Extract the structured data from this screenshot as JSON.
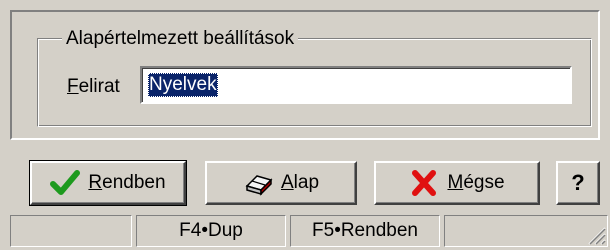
{
  "group": {
    "legend": "Alapértelmezett beállítások",
    "field_label_first": "F",
    "field_label_rest": "elirat",
    "field_value": "Nyelvek"
  },
  "buttons": {
    "ok": {
      "ul": "R",
      "rest": "endben",
      "icon": "checkmark-icon"
    },
    "default": {
      "ul": "A",
      "rest": "lap",
      "icon": "eraser-icon"
    },
    "cancel_prefix": "",
    "cancel": {
      "ul": "M",
      "rest": "égse",
      "icon": "x-icon"
    },
    "help": "?"
  },
  "status_bar": {
    "f4": "F4•Dup",
    "f5": "F5•Rendben"
  },
  "colors": {
    "check": "#1e9a1e",
    "cross": "#e01010",
    "selection": "#0a246a"
  }
}
